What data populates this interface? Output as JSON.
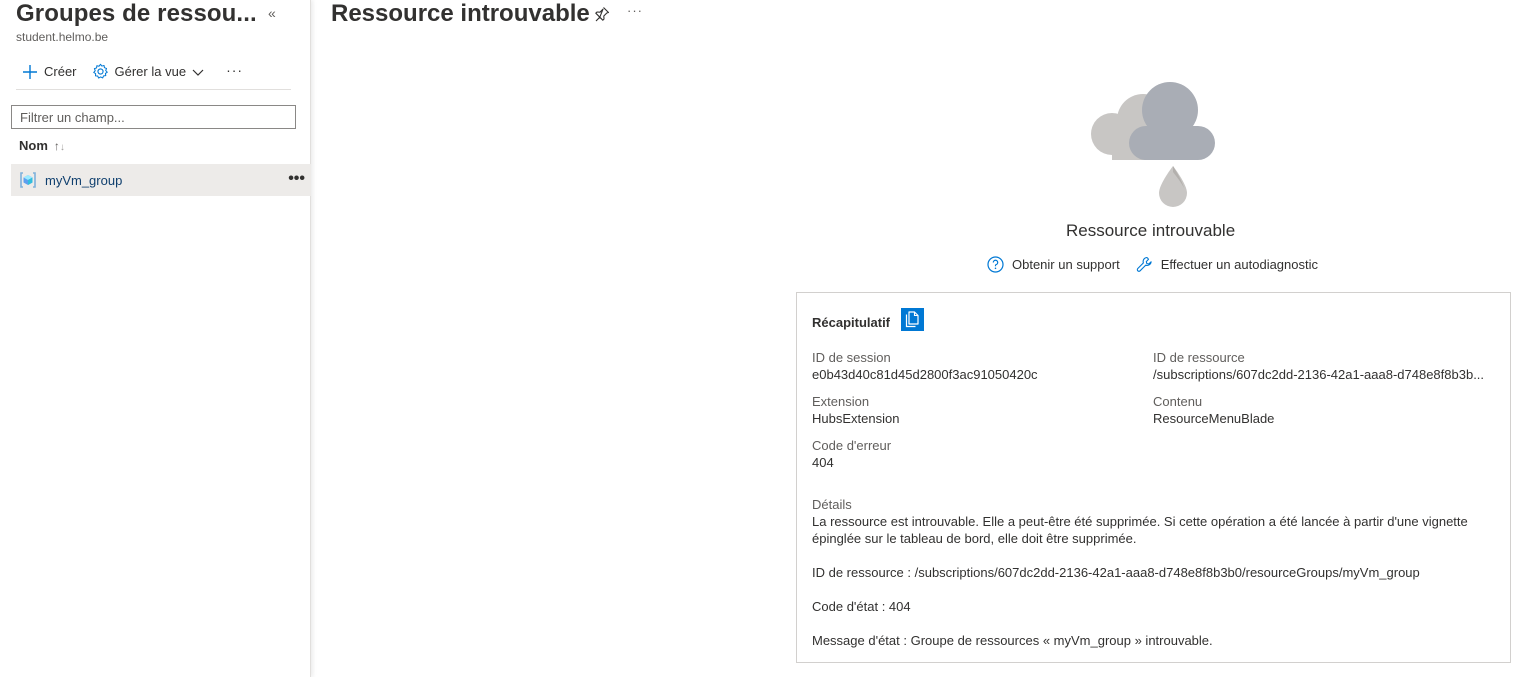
{
  "left_pane": {
    "title": "Groupes de ressou...",
    "collapse_glyph": "«",
    "subtitle": "student.helmo.be",
    "toolbar": {
      "create_label": "Créer",
      "manage_view_label": "Gérer la vue",
      "more_glyph": "···"
    },
    "filter": {
      "placeholder": "Filtrer un champ...",
      "value": ""
    },
    "column_header": {
      "label": "Nom",
      "sort_glyph": "↑"
    },
    "items": [
      {
        "name": "myVm_group",
        "icon": "resource-group-icon",
        "more_glyph": "•••"
      }
    ]
  },
  "main": {
    "title": "Ressource introuvable",
    "more_glyph": "···",
    "error_heading": "Ressource introuvable",
    "links": {
      "support_label": "Obtenir un support",
      "diagnose_label": "Effectuer un autodiagnostic"
    },
    "summary": {
      "header": "Récapitulatif",
      "session_id_label": "ID de session",
      "session_id_value": "e0b43d40c81d45d2800f3ac91050420c",
      "resource_id_label": "ID de ressource",
      "resource_id_value": "/subscriptions/607dc2dd-2136-42a1-aaa8-d748e8f8b3b...",
      "extension_label": "Extension",
      "extension_value": "HubsExtension",
      "content_label": "Contenu",
      "content_value": "ResourceMenuBlade",
      "error_code_label": "Code d'erreur",
      "error_code_value": "404",
      "details_label": "Détails",
      "details_text": "La ressource est introuvable. Elle a peut-être été supprimée. Si cette opération a été lancée à partir d'une vignette épinglée sur le tableau de bord, elle doit être supprimée.",
      "details_resource_id": "ID de ressource : /subscriptions/607dc2dd-2136-42a1-aaa8-d748e8f8b3b0/resourceGroups/myVm_group",
      "details_status_code": "Code d'état : 404",
      "details_status_message": "Message d'état : Groupe de ressources « myVm_group » introuvable."
    }
  },
  "colors": {
    "accent": "#0078d4",
    "selected_row": "#edebe9",
    "link_text": "#0f3f6e",
    "cloud_light": "#c8c6c4",
    "cloud_dark": "#a9adb5"
  }
}
